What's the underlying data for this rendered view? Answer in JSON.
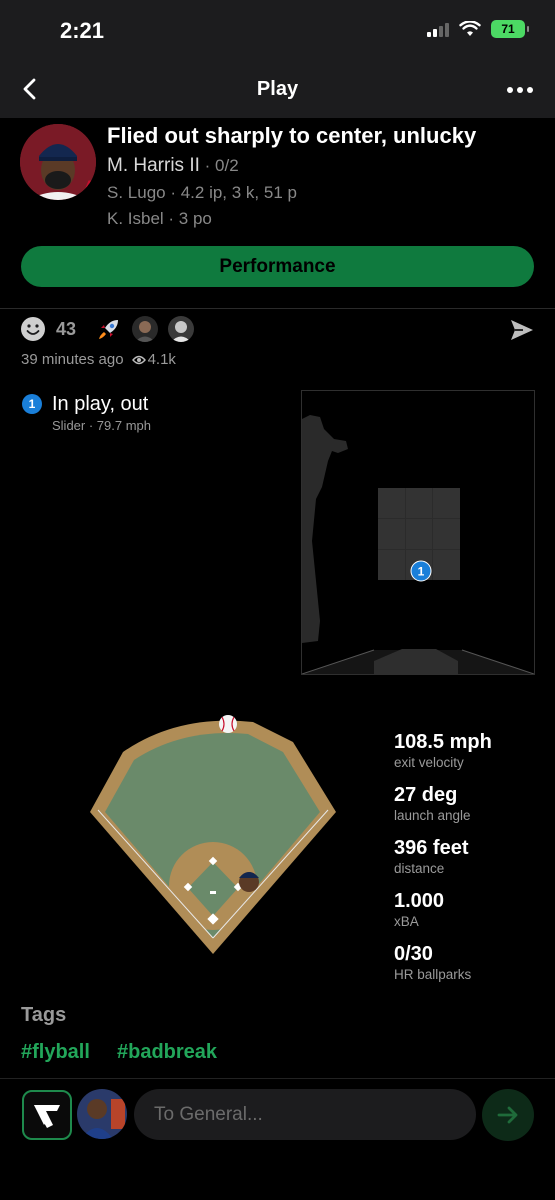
{
  "status_bar": {
    "time": "2:21",
    "battery": "71"
  },
  "nav": {
    "title": "Play",
    "back_icon": "chevron-left-icon",
    "more_icon": "ellipsis-icon"
  },
  "play": {
    "headline": "Flied out sharply to center, unlucky",
    "batter": "M. Harris II",
    "batter_line": "0/2",
    "pitcher_line": "S. Lugo · 4.2 ip, 3 k, 51 p",
    "fielder_line": "K. Isbel · 3 po",
    "performance_label": "Performance"
  },
  "social": {
    "reaction_count": "43",
    "posted_ago": "39 minutes ago",
    "views": "4.1k"
  },
  "pitch": {
    "number": "1",
    "result": "In play, out",
    "detail": "Slider ·  79.7 mph"
  },
  "stats": [
    {
      "value": "108.5 mph",
      "label": "exit velocity"
    },
    {
      "value": "27 deg",
      "label": "launch angle"
    },
    {
      "value": "396 feet",
      "label": "distance"
    },
    {
      "value": "1.000",
      "label": "xBA"
    },
    {
      "value": "0/30",
      "label": "HR ballparks"
    }
  ],
  "tags": {
    "title": "Tags",
    "items": [
      "#flyball",
      "#badbreak"
    ]
  },
  "composer": {
    "placeholder": "To General..."
  },
  "colors": {
    "accent_green": "#0f7a3e",
    "tag_green": "#22a65a",
    "pitch_blue": "#1a7fd9",
    "infield_dirt": "#b08d57",
    "outfield_grass": "#6a8a6a"
  }
}
